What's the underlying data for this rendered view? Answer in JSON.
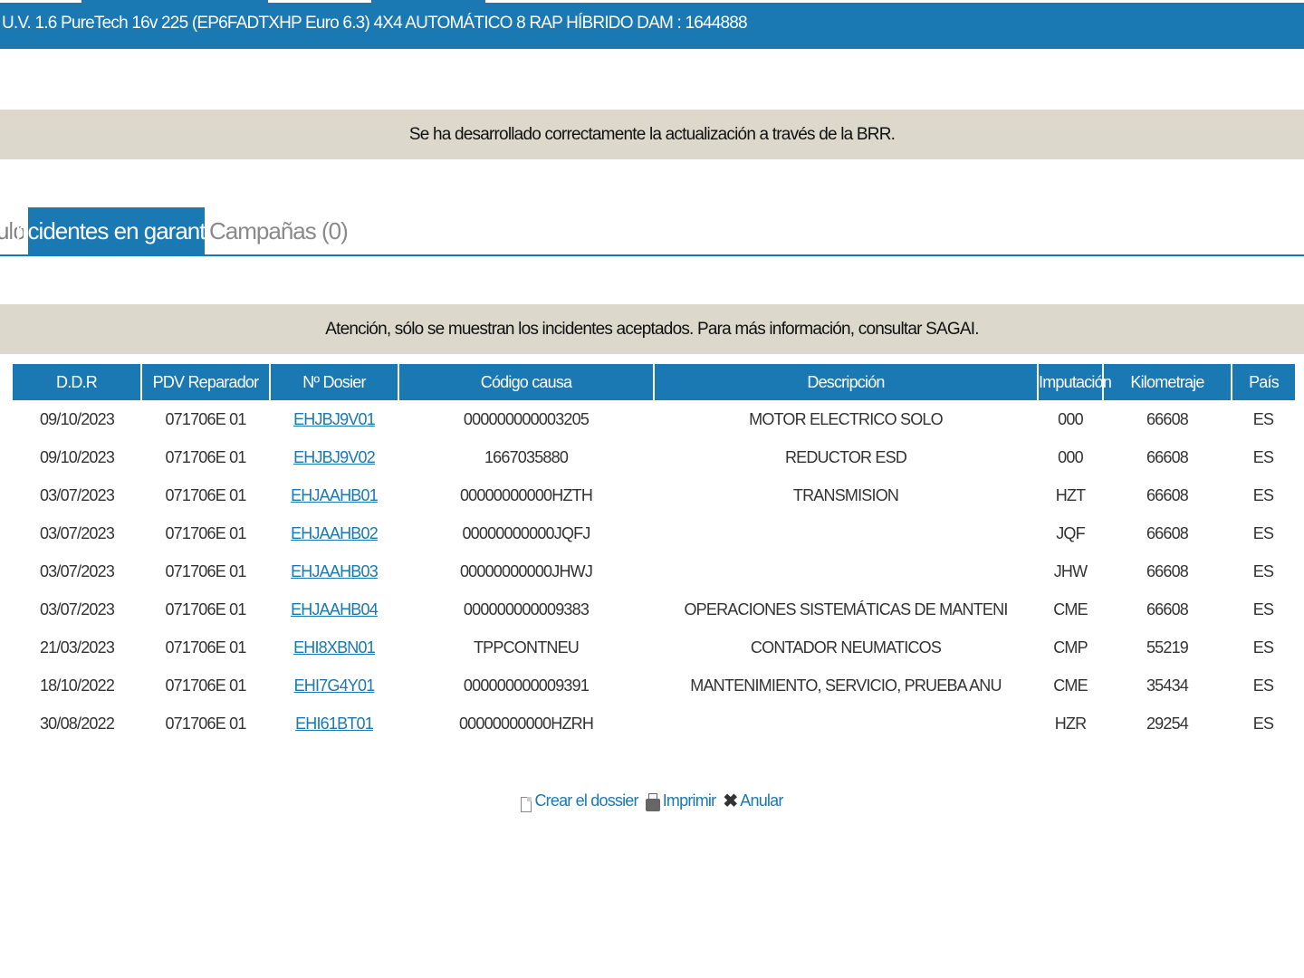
{
  "header": {
    "vehicle_title": "U.V. 1.6 PureTech 16v 225 (EP6FADTXHP Euro 6.3) 4X4 AUTOMÁTICO 8 RAP HÍBRIDO  DAM : 1644888"
  },
  "notices": {
    "success": "Se ha desarrollado correctamente la actualización a través de la BRR.",
    "warning": "Atención, sólo se muestran los incidentes aceptados. Para más información, consultar SAGAI."
  },
  "tabs": {
    "partial": "ulo",
    "active": "Incidentes en garantía",
    "campaigns": "Campañas (0)"
  },
  "table": {
    "headers": [
      "D.D.R",
      "PDV Reparador",
      "Nº Dosier",
      "Código causa",
      "Descripción",
      "Imputación",
      "Kilometraje",
      "País"
    ],
    "rows": [
      [
        "09/10/2023",
        "071706E 01",
        "EHJBJ9V01",
        "000000000003205",
        "MOTOR ELECTRICO SOLO",
        "000",
        "66608",
        "ES"
      ],
      [
        "09/10/2023",
        "071706E 01",
        "EHJBJ9V02",
        "1667035880",
        "REDUCTOR ESD",
        "000",
        "66608",
        "ES"
      ],
      [
        "03/07/2023",
        "071706E 01",
        "EHJAAHB01",
        "00000000000HZTH",
        "TRANSMISION",
        "HZT",
        "66608",
        "ES"
      ],
      [
        "03/07/2023",
        "071706E 01",
        "EHJAAHB02",
        "00000000000JQFJ",
        "",
        "JQF",
        "66608",
        "ES"
      ],
      [
        "03/07/2023",
        "071706E 01",
        "EHJAAHB03",
        "00000000000JHWJ",
        "",
        "JHW",
        "66608",
        "ES"
      ],
      [
        "03/07/2023",
        "071706E 01",
        "EHJAAHB04",
        "000000000009383",
        "OPERACIONES SISTEMÁTICAS DE MANTENI",
        "CME",
        "66608",
        "ES"
      ],
      [
        "21/03/2023",
        "071706E 01",
        "EHI8XBN01",
        "TPPCONTNEU",
        "CONTADOR NEUMATICOS",
        "CMP",
        "55219",
        "ES"
      ],
      [
        "18/10/2022",
        "071706E 01",
        "EHI7G4Y01",
        "000000000009391",
        "MANTENIMIENTO, SERVICIO, PRUEBA ANU",
        "CME",
        "35434",
        "ES"
      ],
      [
        "30/08/2022",
        "071706E 01",
        "EHI61BT01",
        "00000000000HZRH",
        "",
        "HZR",
        "29254",
        "ES"
      ]
    ]
  },
  "actions": {
    "create": {
      "label": "Crear el dossier",
      "icon": "document-icon"
    },
    "print": {
      "label": "Imprimir",
      "icon": "printer-icon"
    },
    "cancel": {
      "label": "Anular",
      "icon": "x-icon"
    }
  },
  "colors": {
    "accent": "#1a79b3",
    "notice_bg": "#dcd8cc"
  }
}
